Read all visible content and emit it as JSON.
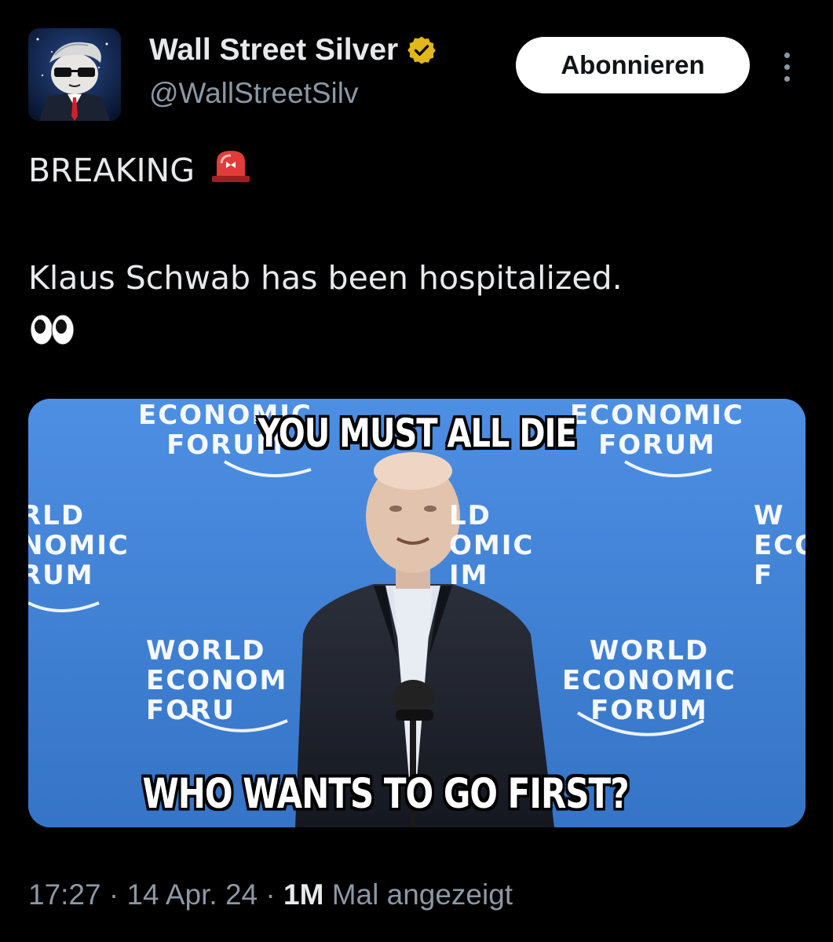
{
  "author": {
    "display_name": "Wall Street Silver",
    "handle": "@WallStreetSilv",
    "verified_icon": "verified-badge-icon",
    "avatar_icon": "avatar-image"
  },
  "actions": {
    "subscribe_label": "Abonnieren",
    "more_icon": "more-options-icon"
  },
  "tweet": {
    "line1": "BREAKING",
    "line1_emoji": "police-siren-icon",
    "line2": "Klaus Schwab has been hospitalized.",
    "line3_emoji": "eyes-icon"
  },
  "media": {
    "top_caption": "YOU MUST ALL DIE",
    "bottom_caption": "WHO WANTS TO GO FIRST?",
    "backdrop_logo_text": [
      "ECONOMIC\nFORUM",
      "ECONOMIC\nFORUM",
      "RLD\nNOMIC\nRUM",
      "LD\nOMIC\nIM",
      "W\nECO\nF",
      "WORLD\nECONOM\nFORU",
      "WORLD\nECONOMIC\nFORUM"
    ]
  },
  "meta": {
    "time": "17:27",
    "date": "14 Apr. 24",
    "views_count": "1M",
    "views_label": "Mal angezeigt",
    "separator": "·"
  },
  "colors": {
    "background": "#000000",
    "primary_text": "#e7e9ea",
    "secondary_text": "#8b98a5",
    "verified_gold": "#e2b719",
    "banner_blue": "#3f82d8"
  }
}
